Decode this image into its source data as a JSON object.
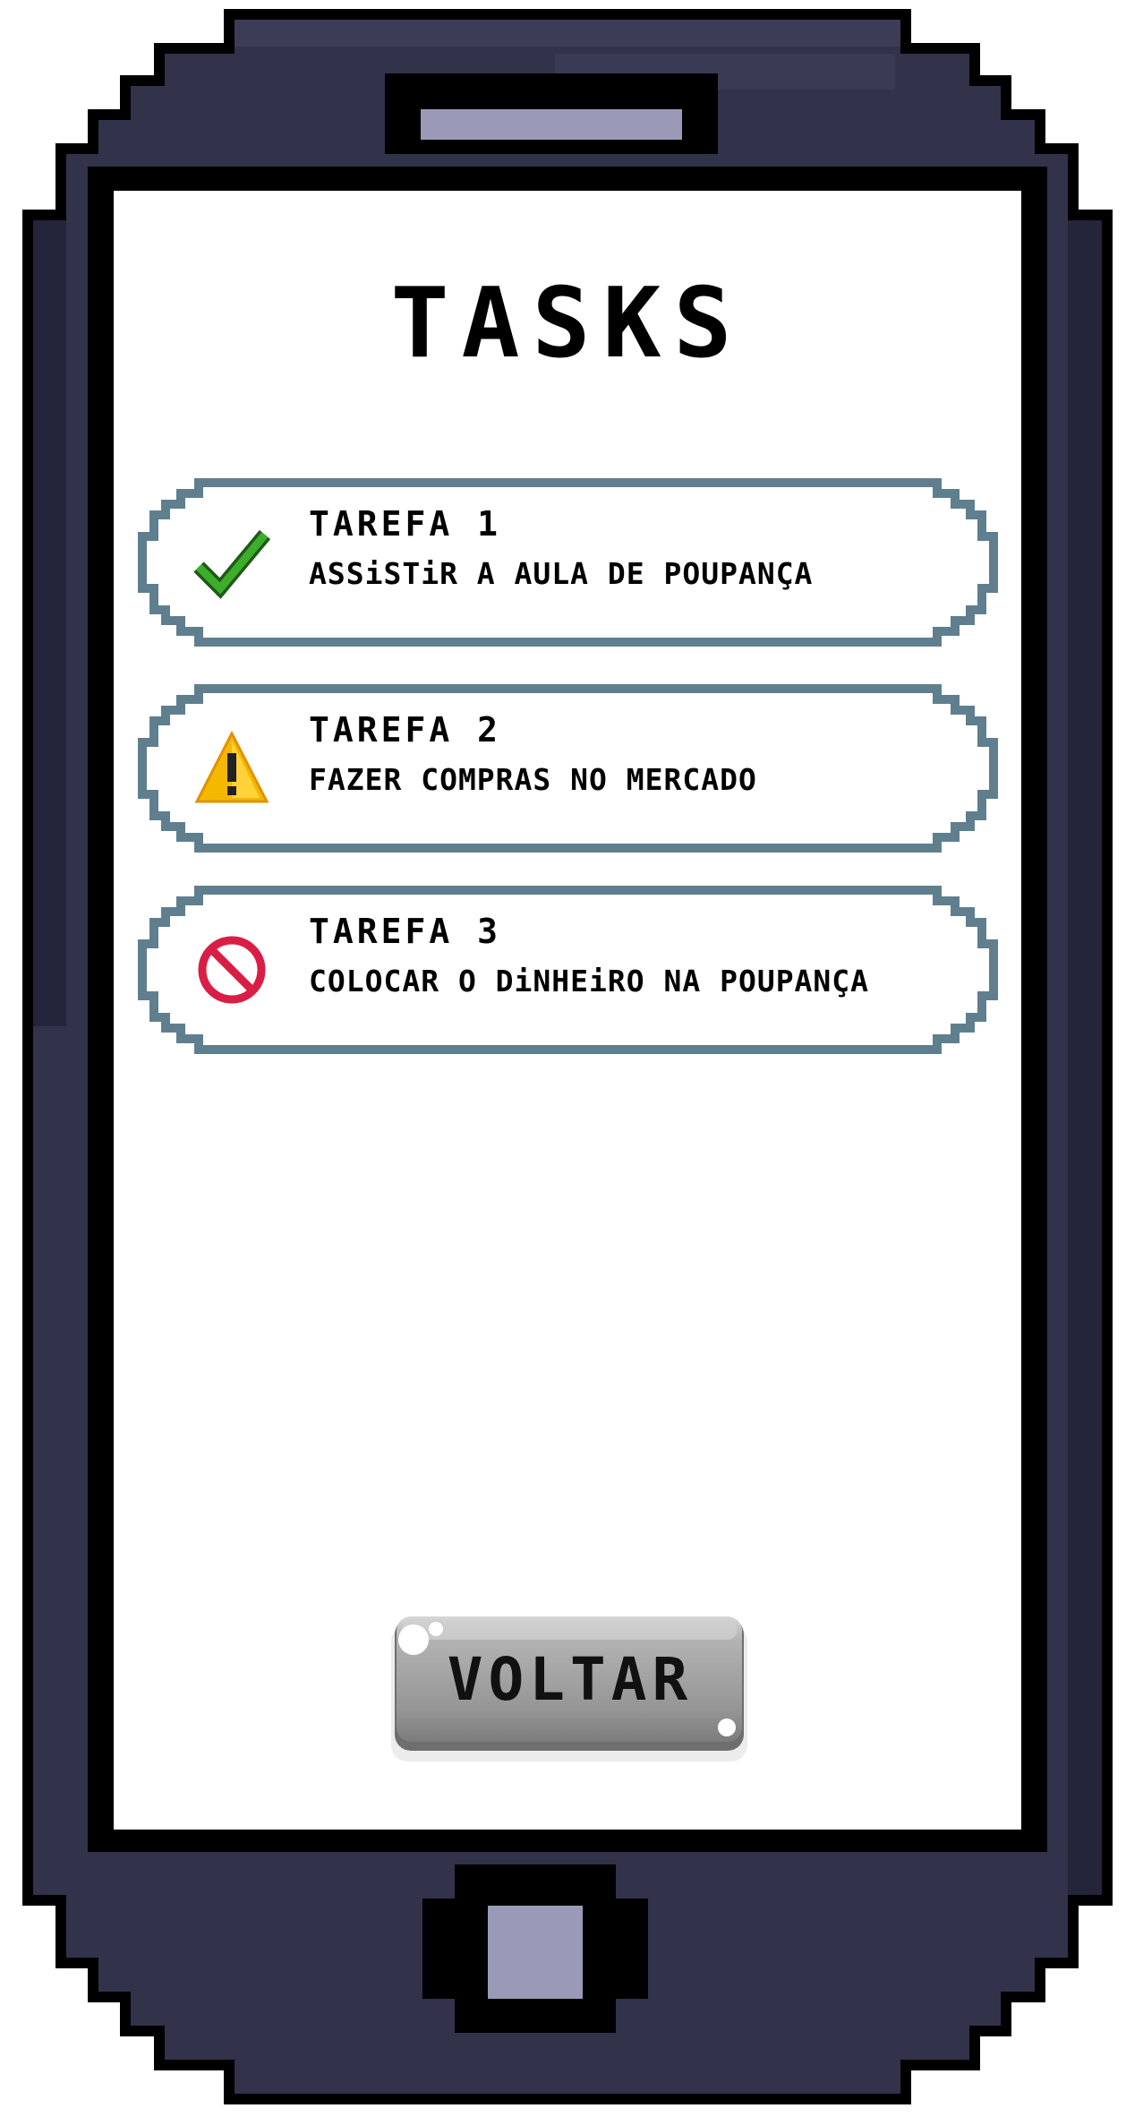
{
  "screen": {
    "title": "TASKS"
  },
  "tasks": [
    {
      "title": "TAREFA 1",
      "description": "ASSiSTiR A AULA DE POUPANÇA",
      "status": "done",
      "icon": "check-icon"
    },
    {
      "title": "TAREFA 2",
      "description": "FAZER COMPRAS NO MERCADO",
      "status": "warning",
      "icon": "warning-icon"
    },
    {
      "title": "TAREFA 3",
      "description": "COLOCAR O DiNHEiRO NA POUPANÇA",
      "status": "blocked",
      "icon": "prohibited-icon"
    }
  ],
  "back_button": {
    "label": "VOLTAR"
  },
  "colors": {
    "phone_body": "#32324a",
    "phone_outline": "#000000",
    "speaker": "#9a9ab8",
    "card_border": "#5f7f8f",
    "check": "#3dae2b",
    "warning": "#f5b800",
    "prohibited": "#d81e45",
    "button_face": "#9a9a9a"
  }
}
